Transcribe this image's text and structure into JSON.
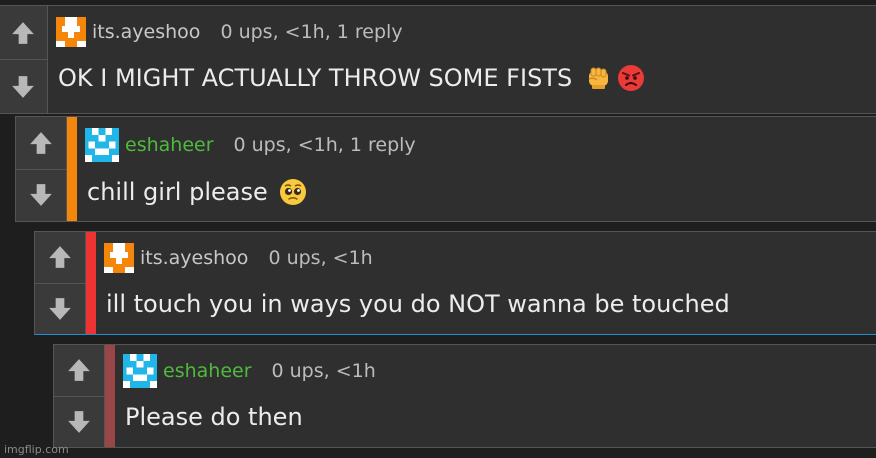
{
  "comments": [
    {
      "username": "its.ayeshoo",
      "meta": "0 ups, <1h, 1 reply",
      "text": "OK I MIGHT ACTUALLY THROW SOME FISTS",
      "emojis": [
        "fist-emoji",
        "angry-face-emoji"
      ],
      "avatar": "orange-pixel-avatar",
      "username_color": "#c8c8c8",
      "bar_color": ""
    },
    {
      "username": "eshaheer",
      "meta": "0 ups, <1h, 1 reply",
      "text": "chill girl please",
      "emojis": [
        "pleading-face-emoji"
      ],
      "avatar": "blue-pixel-avatar",
      "username_color": "#4fba3c",
      "bar_color": "#f4860c"
    },
    {
      "username": "its.ayeshoo",
      "meta": "0 ups, <1h",
      "text": "ill touch you in ways you do NOT wanna be touched",
      "emojis": [],
      "avatar": "orange-pixel-avatar",
      "username_color": "#c8c8c8",
      "bar_color": "#ee3333"
    },
    {
      "username": "eshaheer",
      "meta": "0 ups, <1h",
      "text": "Please do then",
      "emojis": [],
      "avatar": "blue-pixel-avatar",
      "username_color": "#4fba3c",
      "bar_color": "#9a4646"
    }
  ],
  "watermark": "imgflip.com",
  "colors": {
    "page_background": "#1e1e1e",
    "comment_background": "#2f2f2f",
    "vote_column": "#3a3a3a",
    "orange_avatar": "#f4860c",
    "blue_avatar": "#21b6e8",
    "reply_highlight_border": "#1a8fd6"
  }
}
